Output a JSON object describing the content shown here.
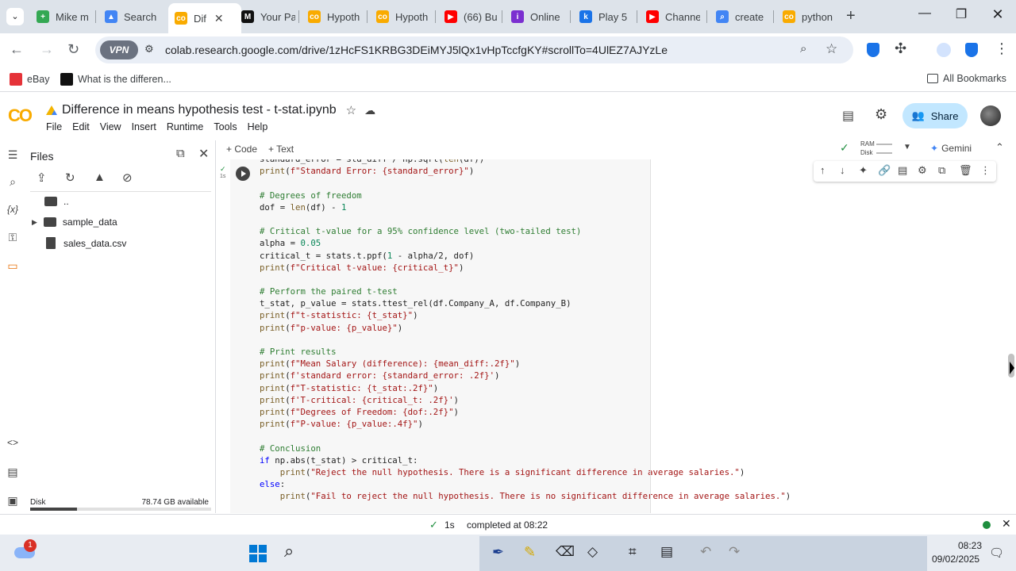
{
  "browser": {
    "tabs": [
      {
        "title": "Mike m",
        "color": "#34a853",
        "glyph": "+"
      },
      {
        "title": "Search",
        "color": "#4285f4",
        "glyph": "▲"
      },
      {
        "title": "Dif",
        "color": "#f9ab00",
        "glyph": "co",
        "active": true
      },
      {
        "title": "Your Pa",
        "color": "#111111",
        "glyph": "M"
      },
      {
        "title": "Hypoth",
        "color": "#f9ab00",
        "glyph": "co"
      },
      {
        "title": "Hypoth",
        "color": "#f9ab00",
        "glyph": "co"
      },
      {
        "title": "(66) Bu",
        "color": "#ff0000",
        "glyph": "▶"
      },
      {
        "title": "Online",
        "color": "#7b2fd0",
        "glyph": "i"
      },
      {
        "title": "Play 5",
        "color": "#1a73e8",
        "glyph": "k"
      },
      {
        "title": "Channe",
        "color": "#ff0000",
        "glyph": "▶"
      },
      {
        "title": "create",
        "color": "#4285f4",
        "glyph": "⌕"
      },
      {
        "title": "python",
        "color": "#f9ab00",
        "glyph": "co"
      }
    ],
    "vpn_label": "VPN",
    "url": "colab.research.google.com/drive/1zHcFS1KRBG3DEiMYJ5lQx1vHpTccfgKY#scrollTo=4UlEZ7AJYzLe",
    "bookmarks": [
      {
        "label": "eBay"
      },
      {
        "label": "What is the differen..."
      }
    ],
    "all_bookmarks": "All Bookmarks"
  },
  "colab": {
    "logo": "CO",
    "title": "Difference in means hypothesis test - t-stat.ipynb",
    "menu": [
      "File",
      "Edit",
      "View",
      "Insert",
      "Runtime",
      "Tools",
      "Help"
    ],
    "share_label": "Share",
    "add_code": "+ Code",
    "add_text": "+ Text",
    "ram_label": "RAM",
    "disk_label": "Disk",
    "gemini_label": "Gemini"
  },
  "files_panel": {
    "title": "Files",
    "items": [
      {
        "name": "..",
        "type": "parent"
      },
      {
        "name": "sample_data",
        "type": "folder"
      },
      {
        "name": "sales_data.csv",
        "type": "file"
      }
    ],
    "disk_label": "Disk",
    "disk_available": "78.74 GB available",
    "disk_used_fraction": 0.26
  },
  "cell": {
    "exec_time": "1s",
    "lines": [
      "standard_error = std_diff / np.sqrt(len(df))",
      "print(f\"Standard Error: {standard_error}\")",
      "",
      "# Degrees of freedom",
      "dof = len(df) - 1",
      "",
      "# Critical t-value for a 95% confidence level (two-tailed test)",
      "alpha = 0.05",
      "critical_t = stats.t.ppf(1 - alpha/2, dof)",
      "print(f\"Critical t-value: {critical_t}\")",
      "",
      "# Perform the paired t-test",
      "t_stat, p_value = stats.ttest_rel(df.Company_A, df.Company_B)",
      "print(f\"t-statistic: {t_stat}\")",
      "print(f\"p-value: {p_value}\")",
      "",
      "# Print results",
      "print(f\"Mean Salary (difference): {mean_diff:.2f}\")",
      "print(f'standard error: {standard_error: .2f}')",
      "print(f\"T-statistic: {t_stat:.2f}\")",
      "print(f'T-critical: {critical_t: .2f}')",
      "print(f\"Degrees of Freedom: {dof:.2f}\")",
      "print(f\"P-value: {p_value:.4f}\")",
      "",
      "# Conclusion",
      "if np.abs(t_stat) > critical_t:",
      "    print(\"Reject the null hypothesis. There is a significant difference in average salaries.\")",
      "else:",
      "    print(\"Fail to reject the null hypothesis. There is no significant difference in average salaries.\")"
    ]
  },
  "status": {
    "time": "1s",
    "message": "completed at 08:22"
  },
  "taskbar": {
    "notification_count": "1",
    "clock_time": "08:23",
    "clock_date": "09/02/2025"
  },
  "colors": {
    "accent": "#f9ab00",
    "share_bg": "#c2e7ff",
    "status_ok": "#1e8e3e"
  }
}
